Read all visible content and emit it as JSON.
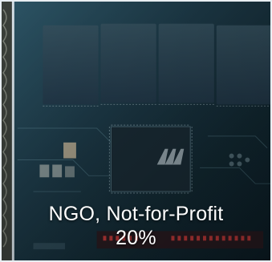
{
  "tile": {
    "label": "NGO, Not-for-Profit",
    "percent": "20%"
  },
  "background": {
    "image": "circuit-board-photo",
    "tint": "#1d3a48"
  }
}
